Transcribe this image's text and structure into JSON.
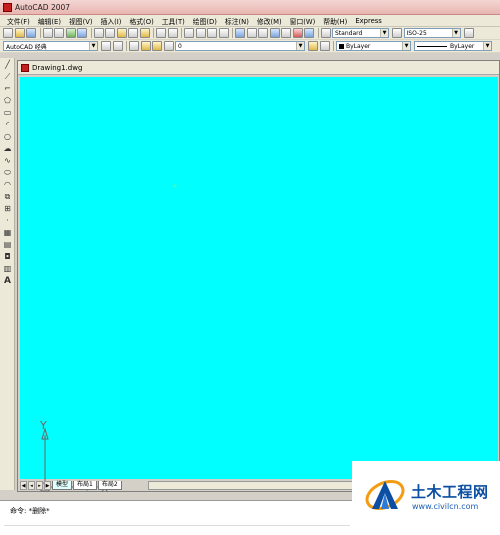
{
  "window": {
    "title": "AutoCAD 2007"
  },
  "menu": [
    "文件(F)",
    "编辑(E)",
    "视图(V)",
    "插入(I)",
    "格式(O)",
    "工具(T)",
    "绘图(D)",
    "标注(N)",
    "修改(M)",
    "窗口(W)",
    "帮助(H)",
    "Express"
  ],
  "toolbar_styles": {
    "text_style": "Standard",
    "dim_style": "ISO-25"
  },
  "workspace": {
    "value": "AutoCAD 经典"
  },
  "layer": {
    "value": "0"
  },
  "properties": {
    "color": "ByLayer",
    "linetype": "ByLayer"
  },
  "document": {
    "title": "Drawing1.dwg",
    "canvas_color": "#00ffff"
  },
  "ucs": {
    "x_label": "X",
    "y_label": "Y"
  },
  "layout_tabs": {
    "model": "模型",
    "layout1": "布局1",
    "layout2": "布局2"
  },
  "command": {
    "text": "命令: *删除*"
  },
  "watermark": {
    "title": "土木工程网",
    "url": "www.civilcn.com"
  },
  "left_tools": [
    "line-icon",
    "construction-line-icon",
    "polyline-icon",
    "polygon-icon",
    "rectangle-icon",
    "arc-icon",
    "circle-icon",
    "revision-cloud-icon",
    "spline-icon",
    "ellipse-icon",
    "ellipse-arc-icon",
    "insert-block-icon",
    "make-block-icon",
    "point-icon",
    "hatch-icon",
    "gradient-icon",
    "region-icon",
    "table-icon",
    "multiline-text-icon"
  ],
  "colors": {
    "accent": "#0b4ea2",
    "titlebar": "#e9b6b0"
  }
}
